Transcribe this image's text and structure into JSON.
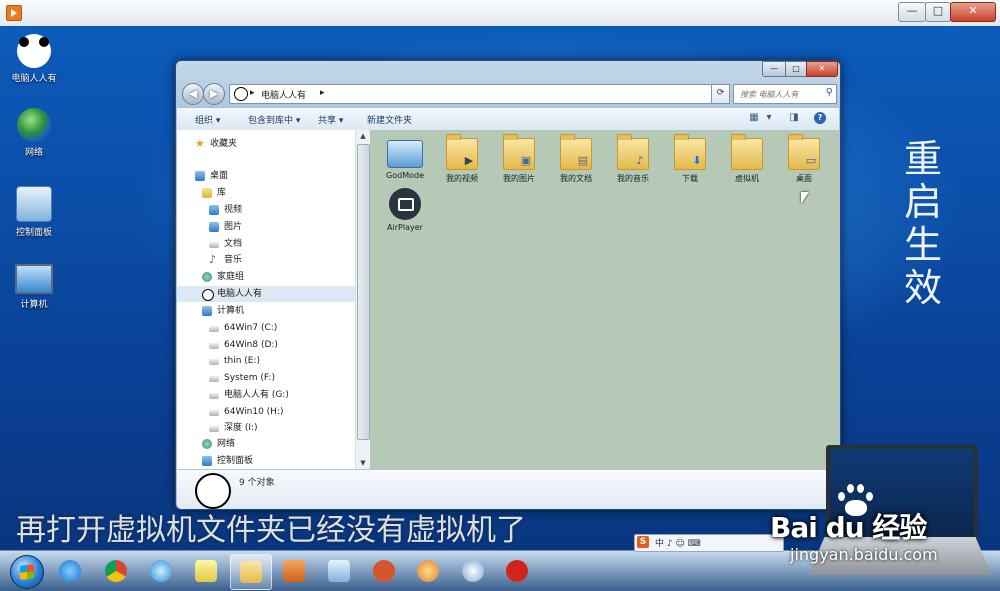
{
  "desktop": {
    "icons": [
      {
        "label": "电脑人人有",
        "icon": "panda-icon"
      },
      {
        "label": "网络",
        "icon": "network-globe-icon"
      },
      {
        "label": "控制面板",
        "icon": "control-panel-icon"
      },
      {
        "label": "计算机",
        "icon": "computer-icon"
      }
    ],
    "vertical_text": "重启生效",
    "caption": "再打开虚拟机文件夹已经没有虚拟机了"
  },
  "explorer": {
    "window_controls": {
      "minimize": "—",
      "maximize": "□",
      "close": "✕"
    },
    "address": {
      "segment": "电脑人人有",
      "separator": "▸",
      "dropdown": "▾",
      "refresh": "⟳"
    },
    "search": {
      "placeholder": "搜索 电脑人人有"
    },
    "toolbar": {
      "organize": "组织 ▾",
      "include_in_library": "包含到库中 ▾",
      "share": "共享 ▾",
      "new_folder": "新建文件夹"
    },
    "nav": {
      "favorites": "收藏夹",
      "desktop": "桌面",
      "libraries": "库",
      "videos": "视频",
      "pictures": "图片",
      "documents": "文档",
      "music": "音乐",
      "homegroup": "家庭组",
      "user_folder": "电脑人人有",
      "computer": "计算机",
      "drives": [
        "64Win7  (C:)",
        "64Win8  (D:)",
        "thin  (E:)",
        "System  (F:)",
        "电脑人人有  (G:)",
        "64Win10  (H:)",
        "深度  (I:)"
      ],
      "network": "网络",
      "control_panel": "控制面板"
    },
    "items": [
      {
        "label": "GodMode",
        "icon": "godmode-icon"
      },
      {
        "label": "我的视频",
        "icon": "videos-folder-icon"
      },
      {
        "label": "我的图片",
        "icon": "pictures-folder-icon"
      },
      {
        "label": "我的文档",
        "icon": "documents-folder-icon"
      },
      {
        "label": "我的音乐",
        "icon": "music-folder-icon"
      },
      {
        "label": "下载",
        "icon": "downloads-folder-icon"
      },
      {
        "label": "虚拟机",
        "icon": "folder-icon"
      },
      {
        "label": "桌面",
        "icon": "desktop-folder-icon"
      },
      {
        "label": "AirPlayer",
        "icon": "airplayer-icon"
      }
    ],
    "status": {
      "count": "9 个对象"
    }
  },
  "tray": {
    "s_logo": "S",
    "ime": "中 ♪ ☺ ⌨"
  },
  "watermark": {
    "brand": "Bai du 经验",
    "url": "jingyan.baidu.com"
  },
  "colors": {
    "desktop_blue": "#0c5bbb",
    "content_bg": "#b6c9b7",
    "nav_select": "#dce8f4"
  }
}
